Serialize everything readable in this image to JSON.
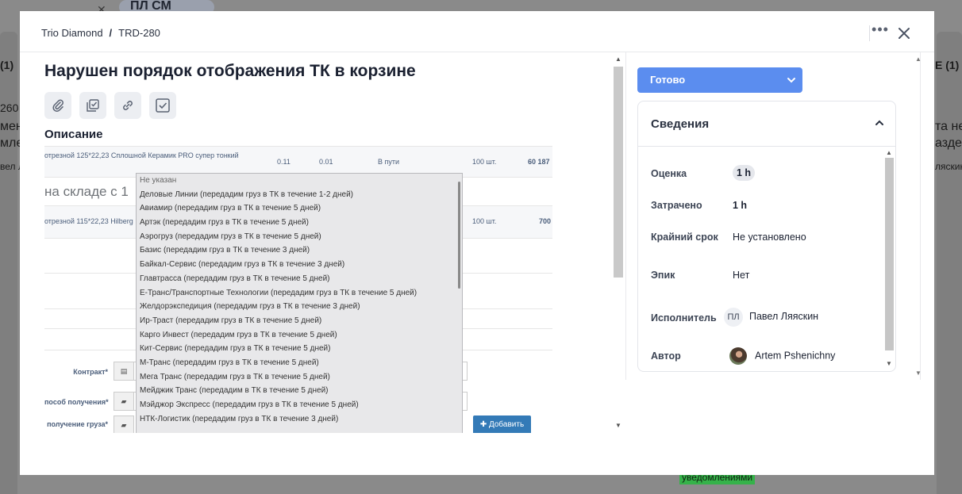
{
  "background": {
    "top_chip": "ПЛ СМ",
    "left_fragments": [
      "(1)",
      "260",
      "мени",
      "млен",
      "вел Л"
    ],
    "right_fragments": [
      "E (1)",
      "та не",
      "азде",
      "ляскин"
    ],
    "green_tag": "уведомлениями"
  },
  "modal": {
    "breadcrumb": {
      "project": "Trio Diamond",
      "separator": "/",
      "issue": "TRD-280"
    },
    "title": "Нарушен порядок отображения ТК в корзине",
    "toolbar": {
      "attach": "paperclip-icon",
      "subtasks": "stacked-checklist-icon",
      "link": "link-icon",
      "checklist": "checkbox-icon"
    },
    "description_label": "Описание",
    "embed": {
      "row1": {
        "product": "отрезной 125*22,23 Сплошной Керамик PRO супер тонкий",
        "c1": "0.11",
        "c2": "0.01",
        "status": "В пути",
        "qty": "100 шт.",
        "sum": "60 187"
      },
      "stock_text": "на складе с 1",
      "row2": {
        "product": "отрезной 115*22,23 Hilberg E",
        "qty": "100 шт.",
        "sum": "700"
      },
      "labels": {
        "contract": "Контракт*",
        "delivery_method": "пособ получения*",
        "cargo_receipt": "получение груза*"
      },
      "add_button": "Добавить",
      "dropdown": [
        "Не указан",
        "Деловые Линии (передадим груз в ТК в течение 1-2 дней)",
        "Авиамир (передадим груз в ТК в течение 5 дней)",
        "Артэк (передадим груз в ТК в течение 5 дней)",
        "Аэрогруз (передадим груз в ТК в течение 5 дней)",
        "Базис (передадим груз в ТК в течение 3 дней)",
        "Байкал-Сервис (передадим груз в ТК в течение 3 дней)",
        "Главтрасса (передадим груз в ТК в течение 5 дней)",
        "Е-Транс/Транспортные Технологии (передадим груз в ТК в течение 5 дней)",
        "Желдорэкспедиция (передадим груз в ТК в течение 3 дней)",
        "Ир-Траст (передадим груз в ТК в течение 5 дней)",
        "Карго Инвест (передадим груз в ТК в течение 5 дней)",
        "Кит-Сервис (передадим груз в ТК в течение 5 дней)",
        "М-Транс (передадим груз в ТК в течение 5 дней)",
        "Мега Транс (передадим груз в ТК в течение 5 дней)",
        "Мейджик Транс (передадим в ТК в течение 5 дней)",
        "Мэйджор Экспресс (передадим груз в ТК в течение 5 дней)",
        "НТК-Логистик (передадим груз в ТК в течение 3 дней)"
      ]
    },
    "status": {
      "label": "Готово",
      "color": "#5b8def"
    },
    "details": {
      "title": "Сведения",
      "estimate_label": "Оценка",
      "estimate_value": "1 h",
      "spent_label": "Затрачено",
      "spent_value": "1 h",
      "deadline_label": "Крайний срок",
      "deadline_value": "Не установлено",
      "epic_label": "Эпик",
      "epic_value": "Нет",
      "assignee_label": "Исполнитель",
      "assignee_initials": "ПЛ",
      "assignee_name": "Павел Ляяскин",
      "author_label": "Автор",
      "author_name": "Artem Pshenichny"
    }
  }
}
